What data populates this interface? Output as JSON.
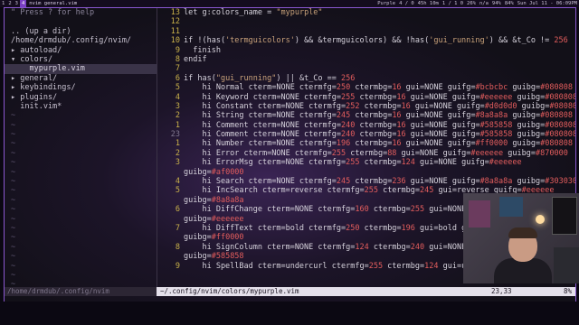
{
  "topbar": {
    "workspaces": [
      "1",
      "2",
      "3",
      "4"
    ],
    "active_workspace": "4",
    "window_title": "nvim general.vim",
    "status": [
      "Purple",
      "4 / 0",
      "45h 10m",
      "1 / 1 0",
      "26%",
      "n/a",
      "94%",
      "84%",
      "Sun Jul 11 - 06:09PM"
    ]
  },
  "tree": {
    "help": "\" Press ? for help",
    "up": ".. (up a dir)",
    "root": "/home/drmdub/.config/nvim/",
    "items": [
      "▸ autoload/",
      "▾ colors/",
      "    mypurple.vim",
      "▸ general/",
      "▸ keybindings/",
      "▸ plugins/",
      "  init.vim*"
    ],
    "selected_index": 2,
    "tilde": "~"
  },
  "editor": {
    "lines": [
      {
        "num": "13",
        "segs": [
          [
            "k",
            "let g:colors_name = "
          ],
          [
            "str",
            "\"mypurple\""
          ]
        ]
      },
      {
        "num": "12",
        "segs": []
      },
      {
        "num": "11",
        "segs": []
      },
      {
        "num": "10",
        "segs": [
          [
            "k",
            "if !(has("
          ],
          [
            "str",
            "'termguicolors'"
          ],
          [
            "k",
            ") && &termguicolors) && !has("
          ],
          [
            "str",
            "'gui_running'"
          ],
          [
            "k",
            ") && &t_Co != "
          ],
          [
            "num",
            "256"
          ]
        ]
      },
      {
        "num": "9",
        "segs": [
          [
            "k",
            "  finish"
          ]
        ]
      },
      {
        "num": "8",
        "segs": [
          [
            "k",
            "endif"
          ]
        ]
      },
      {
        "num": "7",
        "segs": []
      },
      {
        "num": "6",
        "segs": [
          [
            "k",
            "if has("
          ],
          [
            "str",
            "\"gui_running\""
          ],
          [
            "k",
            ") || &t_Co == "
          ],
          [
            "num",
            "256"
          ]
        ]
      },
      {
        "num": "5",
        "segs": [
          [
            "k",
            "    hi Normal cterm=NONE ctermfg="
          ],
          [
            "num",
            "250"
          ],
          [
            "k",
            " ctermbg="
          ],
          [
            "num",
            "16"
          ],
          [
            "k",
            " gui=NONE guifg="
          ],
          [
            "red",
            "#bcbcbc"
          ],
          [
            "k",
            " guibg="
          ],
          [
            "red",
            "#080808"
          ]
        ]
      },
      {
        "num": "4",
        "segs": [
          [
            "k",
            "    hi Keyword cterm=NONE ctermfg="
          ],
          [
            "num",
            "255"
          ],
          [
            "k",
            " ctermbg="
          ],
          [
            "num",
            "16"
          ],
          [
            "k",
            " gui=NONE guifg="
          ],
          [
            "red",
            "#eeeeee"
          ],
          [
            "k",
            " guibg="
          ],
          [
            "red",
            "#080808"
          ]
        ]
      },
      {
        "num": "3",
        "segs": [
          [
            "k",
            "    hi Constant cterm=NONE ctermfg="
          ],
          [
            "num",
            "252"
          ],
          [
            "k",
            " ctermbg="
          ],
          [
            "num",
            "16"
          ],
          [
            "k",
            " gui=NONE guifg="
          ],
          [
            "red",
            "#d0d0d0"
          ],
          [
            "k",
            " guibg="
          ],
          [
            "red",
            "#080808"
          ]
        ]
      },
      {
        "num": "2",
        "segs": [
          [
            "k",
            "    hi String cterm=NONE ctermfg="
          ],
          [
            "num",
            "245"
          ],
          [
            "k",
            " ctermbg="
          ],
          [
            "num",
            "16"
          ],
          [
            "k",
            " gui=NONE guifg="
          ],
          [
            "red",
            "#8a8a8a"
          ],
          [
            "k",
            " guibg="
          ],
          [
            "red",
            "#080808"
          ]
        ]
      },
      {
        "num": "1",
        "segs": [
          [
            "k",
            "    hi Comment cterm=NONE ctermfg="
          ],
          [
            "num",
            "240"
          ],
          [
            "k",
            " ctermbg="
          ],
          [
            "num",
            "16"
          ],
          [
            "k",
            " gui=NONE guifg="
          ],
          [
            "red",
            "#585858"
          ],
          [
            "k",
            " guibg="
          ],
          [
            "red",
            "#080808"
          ]
        ]
      },
      {
        "num": "23",
        "dim": true,
        "segs": [
          [
            "k",
            "    hi Comment cterm=NONE ctermfg="
          ],
          [
            "num",
            "240"
          ],
          [
            "k",
            " ctermbg="
          ],
          [
            "num",
            "16"
          ],
          [
            "k",
            " gui=NONE guifg="
          ],
          [
            "red",
            "#585858"
          ],
          [
            "k",
            " guibg="
          ],
          [
            "red",
            "#080808"
          ]
        ]
      },
      {
        "num": "1",
        "segs": [
          [
            "k",
            "    hi Number cterm=NONE ctermfg="
          ],
          [
            "num",
            "196"
          ],
          [
            "k",
            " ctermbg="
          ],
          [
            "num",
            "16"
          ],
          [
            "k",
            " gui=NONE guifg="
          ],
          [
            "red",
            "#ff0000"
          ],
          [
            "k",
            " guibg="
          ],
          [
            "red",
            "#080808"
          ]
        ]
      },
      {
        "num": "2",
        "segs": [
          [
            "k",
            "    hi Error cterm=NONE ctermfg="
          ],
          [
            "num",
            "255"
          ],
          [
            "k",
            " ctermbg="
          ],
          [
            "num",
            "88"
          ],
          [
            "k",
            " gui=NONE guifg="
          ],
          [
            "red",
            "#eeeeee"
          ],
          [
            "k",
            " guibg="
          ],
          [
            "red",
            "#870000"
          ]
        ]
      },
      {
        "num": "3",
        "segs": [
          [
            "k",
            "    hi ErrorMsg cterm=NONE ctermfg="
          ],
          [
            "num",
            "255"
          ],
          [
            "k",
            " ctermbg="
          ],
          [
            "num",
            "124"
          ],
          [
            "k",
            " gui=NONE guifg="
          ],
          [
            "red",
            "#eeeeee"
          ]
        ]
      },
      {
        "num": "",
        "segs": [
          [
            "k",
            "guibg="
          ],
          [
            "red",
            "#af0000"
          ]
        ]
      },
      {
        "num": "4",
        "segs": [
          [
            "k",
            "    hi Search cterm=NONE ctermfg="
          ],
          [
            "num",
            "245"
          ],
          [
            "k",
            " ctermbg="
          ],
          [
            "num",
            "236"
          ],
          [
            "k",
            " gui=NONE guifg="
          ],
          [
            "red",
            "#8a8a8a"
          ],
          [
            "k",
            " guibg="
          ],
          [
            "red",
            "#303030"
          ]
        ]
      },
      {
        "num": "5",
        "segs": [
          [
            "k",
            "    hi IncSearch cterm=reverse ctermfg="
          ],
          [
            "num",
            "255"
          ],
          [
            "k",
            " ctermbg="
          ],
          [
            "num",
            "245"
          ],
          [
            "k",
            " gui=reverse guifg="
          ],
          [
            "red",
            "#eeeeee"
          ]
        ]
      },
      {
        "num": "",
        "segs": [
          [
            "k",
            "guibg="
          ],
          [
            "red",
            "#8a8a8a"
          ]
        ]
      },
      {
        "num": "6",
        "segs": [
          [
            "k",
            "    hi DiffChange cterm=NONE ctermfg="
          ],
          [
            "num",
            "160"
          ],
          [
            "k",
            " ctermbg="
          ],
          [
            "num",
            "255"
          ],
          [
            "k",
            " gui=NONE guifg="
          ],
          [
            "red",
            "#d70000"
          ]
        ]
      },
      {
        "num": "",
        "segs": [
          [
            "k",
            "guibg="
          ],
          [
            "red",
            "#eeeeee"
          ]
        ]
      },
      {
        "num": "7",
        "segs": [
          [
            "k",
            "    hi DiffText cterm=bold ctermfg="
          ],
          [
            "num",
            "250"
          ],
          [
            "k",
            " ctermbg="
          ],
          [
            "num",
            "196"
          ],
          [
            "k",
            " gui=bold guifg="
          ],
          [
            "red",
            "#bcbcbc"
          ]
        ]
      },
      {
        "num": "",
        "segs": [
          [
            "k",
            "guibg="
          ],
          [
            "red",
            "#ff0000"
          ]
        ]
      },
      {
        "num": "8",
        "segs": [
          [
            "k",
            "    hi SignColumn cterm=NONE ctermfg="
          ],
          [
            "num",
            "124"
          ],
          [
            "k",
            " ctermbg="
          ],
          [
            "num",
            "240"
          ],
          [
            "k",
            " gui=NONE guifg="
          ],
          [
            "red",
            "#af0000"
          ]
        ]
      },
      {
        "num": "",
        "segs": [
          [
            "k",
            "guibg="
          ],
          [
            "red",
            "#585858"
          ]
        ]
      },
      {
        "num": "9",
        "segs": [
          [
            "k",
            "    hi SpellBad cterm=undercurl ctermfg="
          ],
          [
            "num",
            "255"
          ],
          [
            "k",
            " ctermbg="
          ],
          [
            "num",
            "124"
          ],
          [
            "k",
            " gui=undercurl guifg="
          ],
          [
            "red",
            "#eeeeee"
          ]
        ]
      }
    ]
  },
  "statusline": {
    "left": "/home/drmdub/.config/nvim",
    "file": "~/.config/nvim/colors/mypurple.vim",
    "position": "23,33",
    "percent": "8%"
  },
  "colors": {
    "accent": "#8a58d0",
    "line_number": "#c9b14a",
    "number": "#e35d5d",
    "string": "#c9a27a"
  }
}
